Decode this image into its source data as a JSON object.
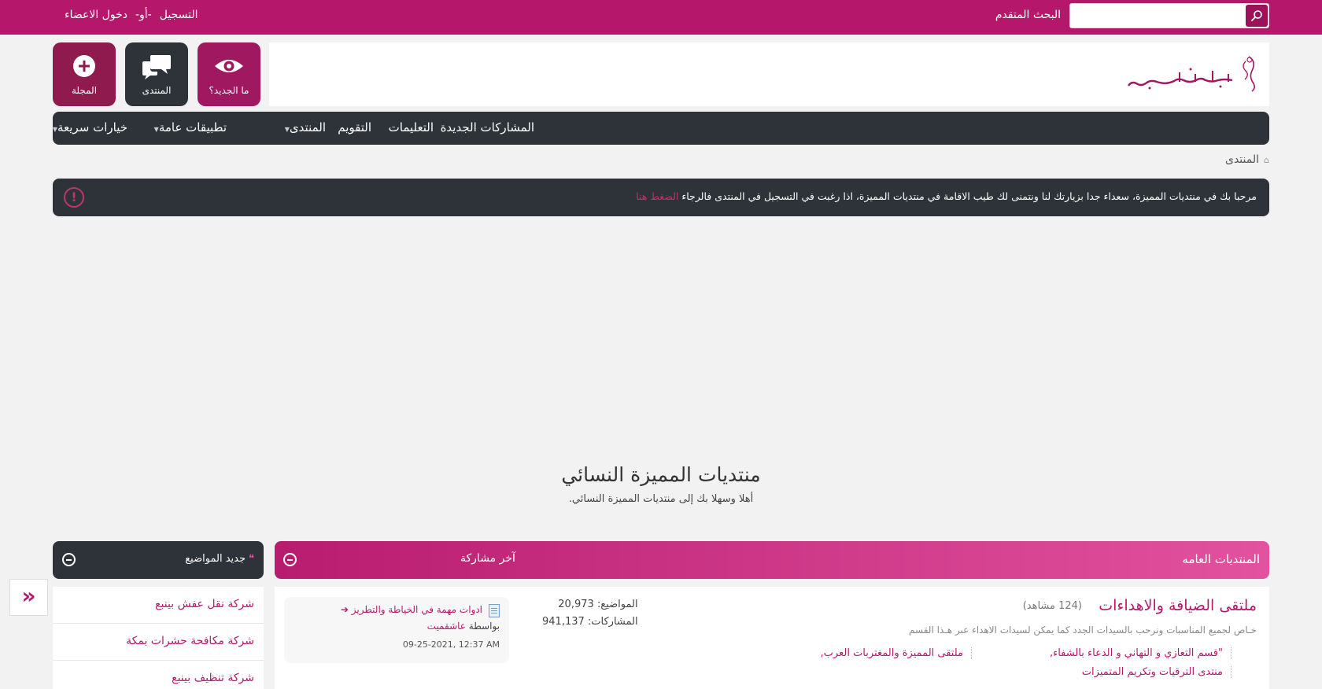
{
  "topbar": {
    "search_placeholder": "",
    "advanced_search": "البحث المتقدم",
    "register": "التسجيل",
    "or": "-أو-",
    "login": "دخول الاعضاء"
  },
  "header": {
    "logo_text": "منتديات المميزة",
    "buttons": [
      {
        "label": "ما الجديد؟",
        "icon": "eye-icon"
      },
      {
        "label": "المنتدى",
        "icon": "chat-bubbles-icon"
      },
      {
        "label": "المجلة",
        "icon": "plus-circle-icon"
      }
    ]
  },
  "navbar": {
    "items": [
      "المشاركات الجديدة",
      "التعليمات",
      "التقويم",
      "المنتدى",
      "تطبيقات عامة",
      "خيارات سريعة"
    ]
  },
  "breadcrumb": {
    "home": "المنتدى"
  },
  "notice": {
    "text": "مرحبا بك في منتديات المميزة، سعداء جدا بزيارتك لنا ونتمنى لك طيب الاقامة في منتديات المميزة، اذا رغبت في التسجيل في المنتدى فالرجاء ",
    "link": "الضغط هنا"
  },
  "site": {
    "title": "منتديات المميزة النسائي",
    "subtitle": "أهلا وسهلا بك إلى منتديات المميزة النسائي."
  },
  "category": {
    "title": "المنتديات العامه",
    "last_post_header": "آخر مشاركة",
    "forum": {
      "name": "ملتقى الضيافة والاهداءات",
      "views": "(124 مشاهد)",
      "description": "خـاص لجميع المناسبات ونرحب بالسيدات الجدد كما يمكن لسيدات الاهداء عبر هـذا القسم",
      "subforums": [
        "\"قسم التعازي و التهاني و الدعاء بالشفاء,",
        "ملتقى المميزة والمغتربات العرب,",
        "منتدى الترقيات وتكريم المتميزات"
      ],
      "topics": "المواضيع: 20,973",
      "posts": "المشاركات: 941,137",
      "last_post": {
        "title": "ادوات مهمة في الخياطة والتطريز",
        "by_label": "بواسطة",
        "author": "عاشقميت",
        "date": "09-25-2021, 12:37 AM"
      }
    }
  },
  "sidebar": {
    "title": "جديد المواضيع",
    "items": [
      "شركة نقل عفش بينبع",
      "شركة مكافحة حشرات بمكة",
      "شركة تنظيف بينبع"
    ]
  },
  "float_button": "«"
}
